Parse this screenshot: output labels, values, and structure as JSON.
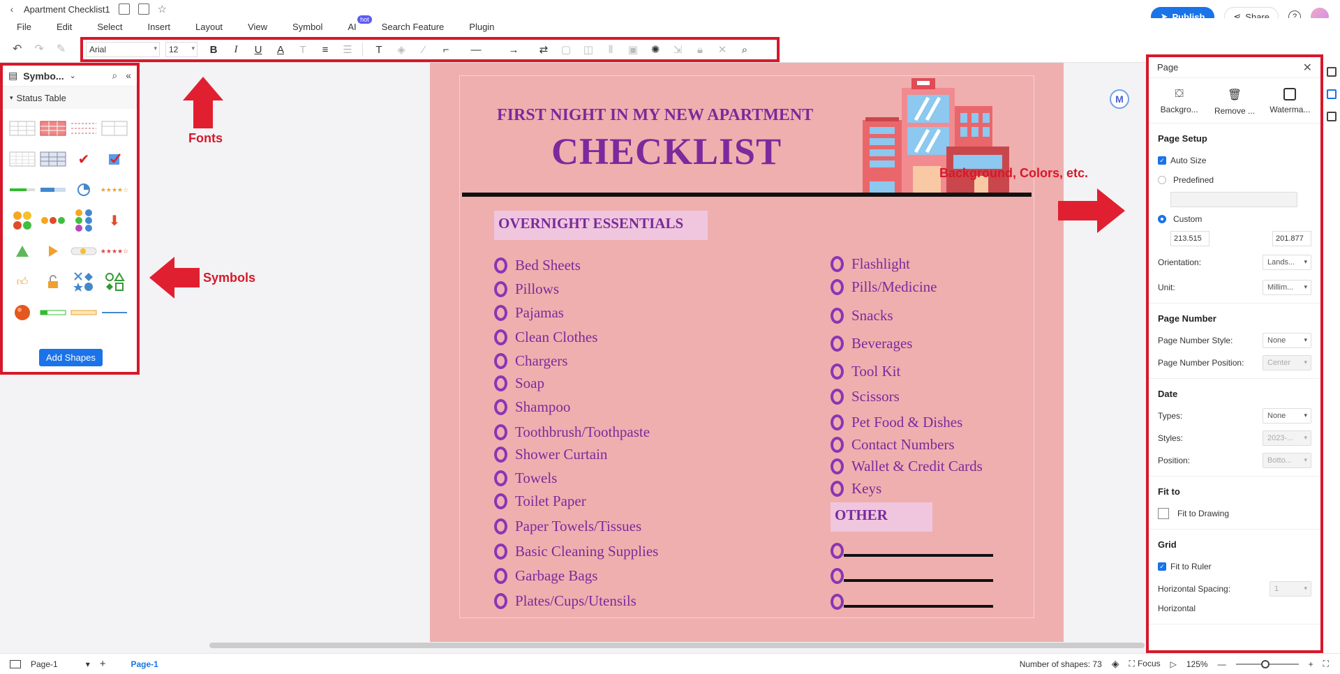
{
  "window": {
    "doc_title": "Apartment Checklist1"
  },
  "menu": [
    "File",
    "Edit",
    "Select",
    "Insert",
    "Layout",
    "View",
    "Symbol",
    "AI",
    "Search Feature",
    "Plugin"
  ],
  "menu_badge": "hot",
  "header": {
    "publish": "Publish",
    "share": "Share"
  },
  "toolbar": {
    "font": "Arial",
    "size": "12"
  },
  "symbols": {
    "title": "Symbo...",
    "category": "Status Table",
    "add_shapes": "Add Shapes"
  },
  "annotations": {
    "fonts": "Fonts",
    "symbols": "Symbols",
    "background": "Background, Colors, etc."
  },
  "checklist": {
    "subtitle": "FIRST NIGHT IN MY NEW APARTMENT",
    "title": "CHECKLIST",
    "section1": "OVERNIGHT ESSENTIALS",
    "left_items": [
      "Bed Sheets",
      "Pillows",
      "Pajamas",
      "Clean Clothes",
      "Chargers",
      "Soap",
      "Shampoo",
      "Toothbrush/Toothpaste",
      "Shower Curtain",
      "Towels",
      "Toilet Paper",
      "Paper Towels/Tissues",
      "Basic Cleaning Supplies",
      "Garbage Bags",
      "Plates/Cups/Utensils"
    ],
    "right_items": [
      "Flashlight",
      "Pills/Medicine",
      "Snacks",
      "Beverages",
      "Tool Kit",
      "Scissors",
      "Pet Food & Dishes",
      "Contact Numbers",
      "Wallet & Credit Cards",
      "Keys"
    ],
    "section2": "OTHER"
  },
  "page_panel": {
    "title": "Page",
    "tools": [
      "Backgro...",
      "Remove ...",
      "Waterma..."
    ],
    "page_setup": "Page Setup",
    "auto_size": "Auto Size",
    "predefined": "Predefined",
    "custom": "Custom",
    "width": "213.515",
    "height": "201.877",
    "orientation_label": "Orientation:",
    "orientation": "Lands...",
    "unit_label": "Unit:",
    "unit": "Millim...",
    "page_number": "Page Number",
    "pn_style_label": "Page Number Style:",
    "pn_style": "None",
    "pn_pos_label": "Page Number Position:",
    "pn_pos": "Center",
    "date": "Date",
    "types_label": "Types:",
    "types": "None",
    "styles_label": "Styles:",
    "styles": "2023-...",
    "position_label": "Position:",
    "position": "Botto...",
    "fit_to": "Fit to",
    "fit_drawing": "Fit to Drawing",
    "grid": "Grid",
    "fit_ruler": "Fit to Ruler",
    "h_spacing_label": "Horizontal Spacing:",
    "h_spacing": "1",
    "horizontal": "Horizontal"
  },
  "status": {
    "page_select": "Page-1",
    "page_tab": "Page-1",
    "shapes": "Number of shapes: 73",
    "focus": "Focus",
    "zoom": "125%"
  }
}
